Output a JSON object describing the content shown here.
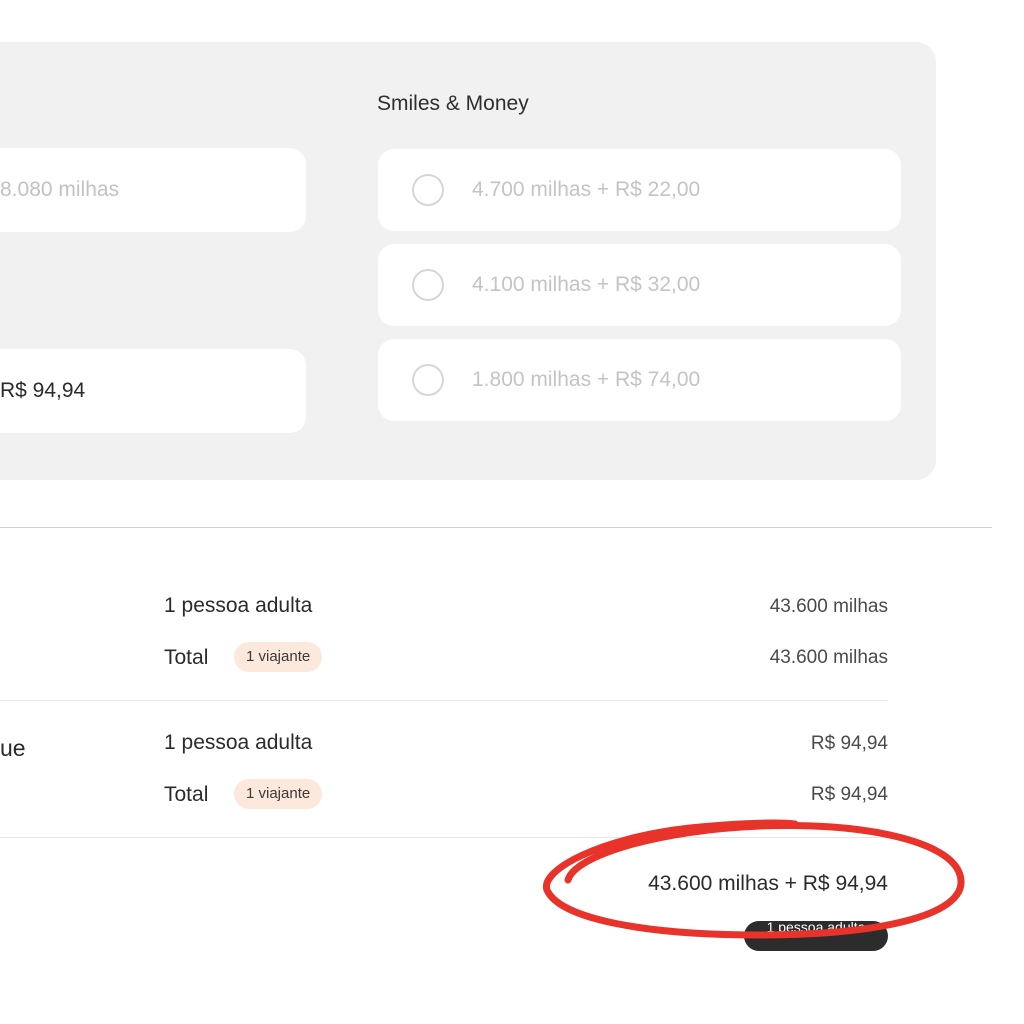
{
  "payment_options": {
    "section_title": "Smiles & Money",
    "left_cards": [
      {
        "label": "8.080 milhas"
      },
      {
        "label": "R$ 94,94"
      }
    ],
    "options": [
      {
        "label": "4.700 milhas + R$ 22,00"
      },
      {
        "label": "4.100 milhas + R$ 32,00"
      },
      {
        "label": "1.800 milhas + R$ 74,00"
      }
    ]
  },
  "summary": {
    "miles_block": {
      "line_label": "1 pessoa adulta",
      "line_value": "43.600 milhas",
      "total_label": "Total",
      "badge": "1 viajante",
      "total_value": "43.600 milhas"
    },
    "money_block": {
      "side_label": "ue",
      "line_label": "1 pessoa adulta",
      "line_value": "R$ 94,94",
      "total_label": "Total",
      "badge": "1 viajante",
      "total_value": "R$ 94,94"
    },
    "grand_total": "43.600 milhas + R$ 94,94",
    "grand_total_badge": "1 pessoa adulta"
  },
  "colors": {
    "panel_bg": "#f1f1f1",
    "badge_bg": "#fde8dc",
    "annotation": "#e8332a"
  }
}
